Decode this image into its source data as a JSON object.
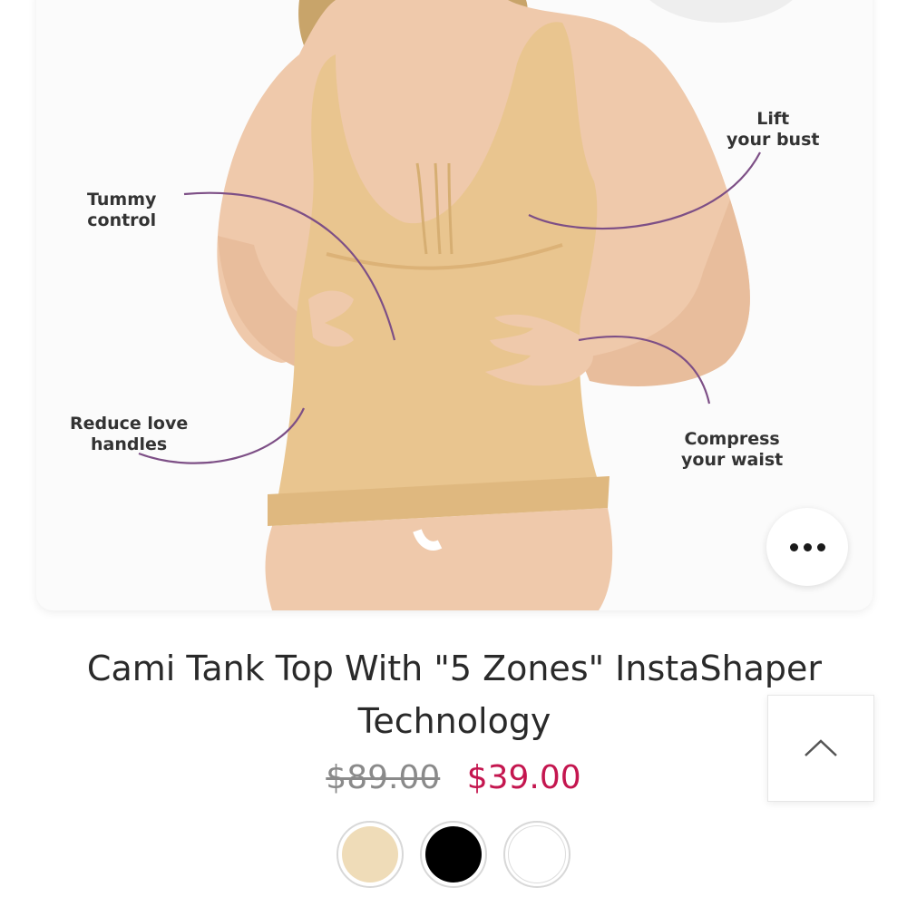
{
  "product": {
    "image": {
      "zones": {
        "lift": [
          "Lift",
          "your bust"
        ],
        "tummy": [
          "Tummy",
          "control"
        ],
        "love_handles": [
          "Reduce love",
          "handles"
        ],
        "waist": [
          "Compress",
          "your waist"
        ]
      },
      "colors": {
        "garment": "#e9c58f",
        "skin": "#efc9ab",
        "callout_line": "#7d4f86"
      }
    },
    "title": "Cami Tank Top With \"5 Zones\" InstaShaper Technology",
    "price": {
      "original": "$89.00",
      "sale": "$39.00",
      "sale_color": "#c4164f"
    },
    "swatches": [
      {
        "color": "#efdcb8"
      },
      {
        "color": "#000000"
      },
      {
        "color": "#ffffff"
      }
    ]
  },
  "actions": {
    "more_icon": "more-horizontal-icon",
    "scroll_top_icon": "chevron-up-icon"
  }
}
